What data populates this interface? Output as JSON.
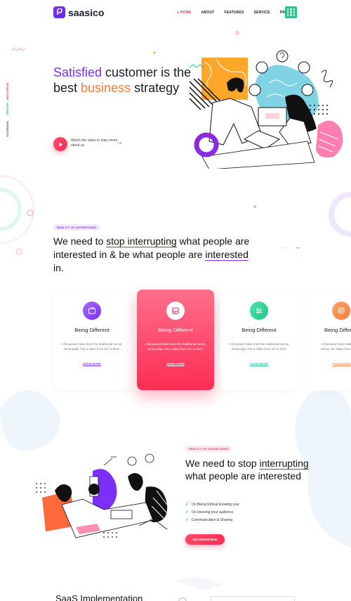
{
  "header": {
    "logo_text": "saasico",
    "nav": [
      {
        "label": "● HOME",
        "active": true
      },
      {
        "label": "ABOUT",
        "active": false
      },
      {
        "label": "FEATURES",
        "active": false
      },
      {
        "label": "SERVICE",
        "active": false
      },
      {
        "label": "PRICING",
        "active": false
      }
    ]
  },
  "social": [
    "INSTAGRAM",
    "TWITTER",
    "FACEBOOK"
  ],
  "hero": {
    "title_part1": "Satisfied",
    "title_part2": " customer is the best ",
    "title_part3": "business",
    "title_part4": " strategy",
    "video_text": "Watch the video to learn more about us"
  },
  "section2": {
    "tag": "REALITY OF ADVERTISING",
    "title_a": "We need to ",
    "title_b": "stop interrupting",
    "title_c": " what people are interested in & be what people are ",
    "title_d": "interested",
    "title_e": " in."
  },
  "cards": [
    {
      "title": "Being Different",
      "desc": "A thousand miles from the traditional sense, technically 730.3 miles from SC to NYC",
      "link": "KNOW MORE",
      "color": "#7b2ff7"
    },
    {
      "title": "Being Different",
      "desc": "A thousand miles from the traditional sense, technically 730.3 miles from SC to NYC",
      "link": "KNOW MORE",
      "color": "#ff2d55"
    },
    {
      "title": "Being Different",
      "desc": "A thousand miles from the traditional sense, technically 730.3 miles from SC to NYC",
      "link": "KNOW MORE",
      "color": "#1ec98b"
    },
    {
      "title": "Being Differ",
      "desc": "A thousand miles traditional sense, tec miles from SC",
      "link": "KNOW MORE",
      "color": "#ff7a3d"
    }
  ],
  "section3": {
    "tag": "REALITY OF ADVERTISING",
    "title_a": "We need to stop ",
    "title_b": "interrupting",
    "title_c": " what people are interested",
    "checks": [
      "On Being Ethical knowing your",
      "On knowing your audience",
      "Communication & Sharing"
    ],
    "cta": "Get Started Now"
  },
  "bottom": {
    "title": "SaaS Implementation"
  }
}
